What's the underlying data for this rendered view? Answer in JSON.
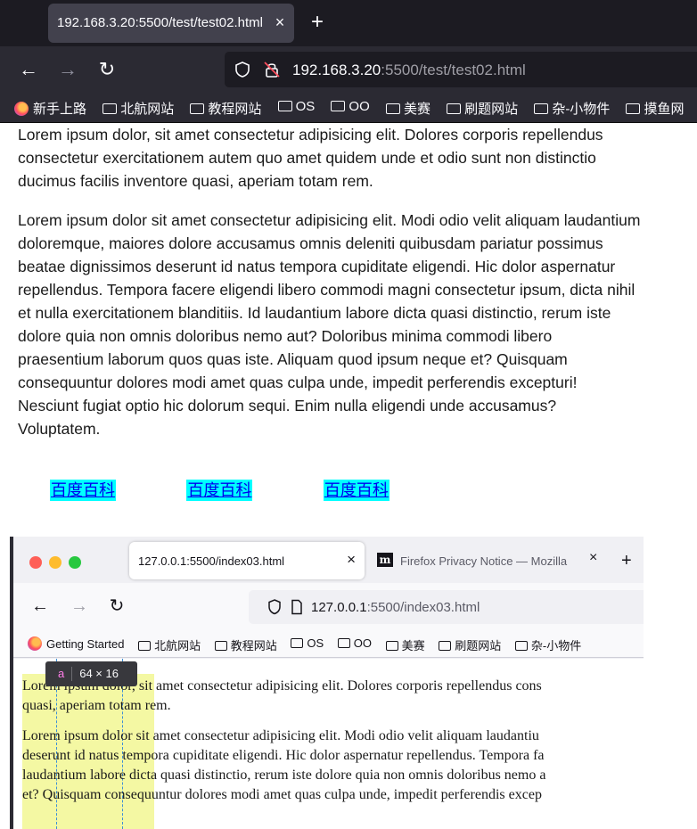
{
  "browser": {
    "tab_title": "192.168.3.20:5500/test/test02.html",
    "tab_close": "×",
    "new_tab": "+",
    "url_host": "192.168.3.20",
    "url_path": ":5500/test/test02.html",
    "bookmarks": [
      "新手上路",
      "北航网站",
      "教程网站",
      "OS",
      "OO",
      "美赛",
      "刷题网站",
      "杂-小物件",
      "摸鱼网"
    ]
  },
  "page": {
    "paragraph1": "Lorem ipsum dolor, sit amet consectetur adipisicing elit. Dolores corporis repellendus consectetur exercitationem autem quo amet quidem unde et odio sunt non distinctio ducimus facilis inventore quasi, aperiam totam rem.",
    "paragraph2": "Lorem ipsum dolor sit amet consectetur adipisicing elit. Modi odio velit aliquam laudantium doloremque, maiores dolore accusamus omnis deleniti quibusdam pariatur possimus beatae dignissimos deserunt id natus tempora cupiditate eligendi. Hic dolor aspernatur repellendus. Tempora facere eligendi libero commodi magni consectetur ipsum, dicta nihil et nulla exercitationem blanditiis. Id laudantium labore dicta quasi distinctio, rerum iste dolore quia non omnis doloribus nemo aut? Doloribus minima commodi libero praesentium laborum quos quas iste. Aliquam quod ipsum neque et? Quisquam consequuntur dolores modi amet quas culpa unde, impedit perferendis excepturi! Nesciunt fugiat optio hic dolorum sequi. Enim nulla eligendi unde accusamus? Voluptatem.",
    "links": [
      "百度百科",
      "百度百科",
      "百度百科"
    ]
  },
  "screenshot": {
    "tab1_title": "127.0.0.1:5500/index03.html",
    "tab1_close": "×",
    "tab2_title": "Firefox Privacy Notice — Mozilla",
    "tab2_icon": "m",
    "tab2_close": "×",
    "new_tab": "+",
    "url_host": "127.0.0.1",
    "url_path": ":5500/index03.html",
    "bookmarks": [
      "Getting Started",
      "北航网站",
      "教程网站",
      "OS",
      "OO",
      "美赛",
      "刷题网站",
      "杂-小物件"
    ],
    "lines": [
      "Lorem ipsum dolor, sit amet consectetur adipisicing elit. Dolores corporis repellendus cons",
      "quasi, aperiam totam rem.",
      "Lorem ipsum dolor sit amet consectetur adipisicing elit. Modi odio velit aliquam laudantiu",
      "deserunt id natus tempora cupiditate eligendi. Hic dolor aspernatur repellendus. Tempora fa",
      "laudantium labore dicta quasi distinctio, rerum iste dolore quia non omnis doloribus nemo a",
      "et? Quisquam consequuntur dolores modi amet quas culpa unde, impedit perferendis excep"
    ],
    "inspector_tag": "a",
    "inspector_dims": "64 × 16"
  },
  "colors": {
    "link_background": "#00ffff",
    "link_text": "#0000ee",
    "highlight": "#e6f032"
  }
}
